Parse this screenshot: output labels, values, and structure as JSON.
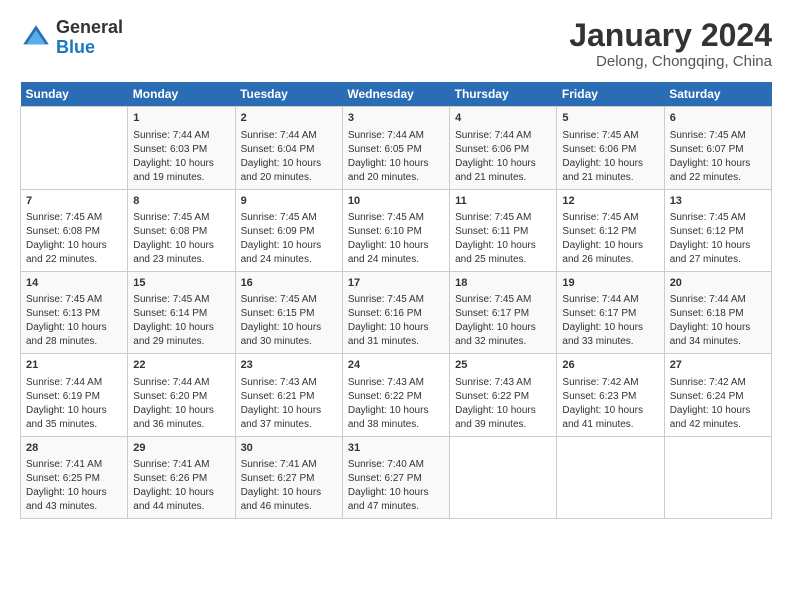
{
  "header": {
    "logo_general": "General",
    "logo_blue": "Blue",
    "month": "January 2024",
    "location": "Delong, Chongqing, China"
  },
  "days_of_week": [
    "Sunday",
    "Monday",
    "Tuesday",
    "Wednesday",
    "Thursday",
    "Friday",
    "Saturday"
  ],
  "weeks": [
    [
      {
        "day": "",
        "sunrise": "",
        "sunset": "",
        "daylight": ""
      },
      {
        "day": "1",
        "sunrise": "Sunrise: 7:44 AM",
        "sunset": "Sunset: 6:03 PM",
        "daylight": "Daylight: 10 hours and 19 minutes."
      },
      {
        "day": "2",
        "sunrise": "Sunrise: 7:44 AM",
        "sunset": "Sunset: 6:04 PM",
        "daylight": "Daylight: 10 hours and 20 minutes."
      },
      {
        "day": "3",
        "sunrise": "Sunrise: 7:44 AM",
        "sunset": "Sunset: 6:05 PM",
        "daylight": "Daylight: 10 hours and 20 minutes."
      },
      {
        "day": "4",
        "sunrise": "Sunrise: 7:44 AM",
        "sunset": "Sunset: 6:06 PM",
        "daylight": "Daylight: 10 hours and 21 minutes."
      },
      {
        "day": "5",
        "sunrise": "Sunrise: 7:45 AM",
        "sunset": "Sunset: 6:06 PM",
        "daylight": "Daylight: 10 hours and 21 minutes."
      },
      {
        "day": "6",
        "sunrise": "Sunrise: 7:45 AM",
        "sunset": "Sunset: 6:07 PM",
        "daylight": "Daylight: 10 hours and 22 minutes."
      }
    ],
    [
      {
        "day": "7",
        "sunrise": "Sunrise: 7:45 AM",
        "sunset": "Sunset: 6:08 PM",
        "daylight": "Daylight: 10 hours and 22 minutes."
      },
      {
        "day": "8",
        "sunrise": "Sunrise: 7:45 AM",
        "sunset": "Sunset: 6:08 PM",
        "daylight": "Daylight: 10 hours and 23 minutes."
      },
      {
        "day": "9",
        "sunrise": "Sunrise: 7:45 AM",
        "sunset": "Sunset: 6:09 PM",
        "daylight": "Daylight: 10 hours and 24 minutes."
      },
      {
        "day": "10",
        "sunrise": "Sunrise: 7:45 AM",
        "sunset": "Sunset: 6:10 PM",
        "daylight": "Daylight: 10 hours and 24 minutes."
      },
      {
        "day": "11",
        "sunrise": "Sunrise: 7:45 AM",
        "sunset": "Sunset: 6:11 PM",
        "daylight": "Daylight: 10 hours and 25 minutes."
      },
      {
        "day": "12",
        "sunrise": "Sunrise: 7:45 AM",
        "sunset": "Sunset: 6:12 PM",
        "daylight": "Daylight: 10 hours and 26 minutes."
      },
      {
        "day": "13",
        "sunrise": "Sunrise: 7:45 AM",
        "sunset": "Sunset: 6:12 PM",
        "daylight": "Daylight: 10 hours and 27 minutes."
      }
    ],
    [
      {
        "day": "14",
        "sunrise": "Sunrise: 7:45 AM",
        "sunset": "Sunset: 6:13 PM",
        "daylight": "Daylight: 10 hours and 28 minutes."
      },
      {
        "day": "15",
        "sunrise": "Sunrise: 7:45 AM",
        "sunset": "Sunset: 6:14 PM",
        "daylight": "Daylight: 10 hours and 29 minutes."
      },
      {
        "day": "16",
        "sunrise": "Sunrise: 7:45 AM",
        "sunset": "Sunset: 6:15 PM",
        "daylight": "Daylight: 10 hours and 30 minutes."
      },
      {
        "day": "17",
        "sunrise": "Sunrise: 7:45 AM",
        "sunset": "Sunset: 6:16 PM",
        "daylight": "Daylight: 10 hours and 31 minutes."
      },
      {
        "day": "18",
        "sunrise": "Sunrise: 7:45 AM",
        "sunset": "Sunset: 6:17 PM",
        "daylight": "Daylight: 10 hours and 32 minutes."
      },
      {
        "day": "19",
        "sunrise": "Sunrise: 7:44 AM",
        "sunset": "Sunset: 6:17 PM",
        "daylight": "Daylight: 10 hours and 33 minutes."
      },
      {
        "day": "20",
        "sunrise": "Sunrise: 7:44 AM",
        "sunset": "Sunset: 6:18 PM",
        "daylight": "Daylight: 10 hours and 34 minutes."
      }
    ],
    [
      {
        "day": "21",
        "sunrise": "Sunrise: 7:44 AM",
        "sunset": "Sunset: 6:19 PM",
        "daylight": "Daylight: 10 hours and 35 minutes."
      },
      {
        "day": "22",
        "sunrise": "Sunrise: 7:44 AM",
        "sunset": "Sunset: 6:20 PM",
        "daylight": "Daylight: 10 hours and 36 minutes."
      },
      {
        "day": "23",
        "sunrise": "Sunrise: 7:43 AM",
        "sunset": "Sunset: 6:21 PM",
        "daylight": "Daylight: 10 hours and 37 minutes."
      },
      {
        "day": "24",
        "sunrise": "Sunrise: 7:43 AM",
        "sunset": "Sunset: 6:22 PM",
        "daylight": "Daylight: 10 hours and 38 minutes."
      },
      {
        "day": "25",
        "sunrise": "Sunrise: 7:43 AM",
        "sunset": "Sunset: 6:22 PM",
        "daylight": "Daylight: 10 hours and 39 minutes."
      },
      {
        "day": "26",
        "sunrise": "Sunrise: 7:42 AM",
        "sunset": "Sunset: 6:23 PM",
        "daylight": "Daylight: 10 hours and 41 minutes."
      },
      {
        "day": "27",
        "sunrise": "Sunrise: 7:42 AM",
        "sunset": "Sunset: 6:24 PM",
        "daylight": "Daylight: 10 hours and 42 minutes."
      }
    ],
    [
      {
        "day": "28",
        "sunrise": "Sunrise: 7:41 AM",
        "sunset": "Sunset: 6:25 PM",
        "daylight": "Daylight: 10 hours and 43 minutes."
      },
      {
        "day": "29",
        "sunrise": "Sunrise: 7:41 AM",
        "sunset": "Sunset: 6:26 PM",
        "daylight": "Daylight: 10 hours and 44 minutes."
      },
      {
        "day": "30",
        "sunrise": "Sunrise: 7:41 AM",
        "sunset": "Sunset: 6:27 PM",
        "daylight": "Daylight: 10 hours and 46 minutes."
      },
      {
        "day": "31",
        "sunrise": "Sunrise: 7:40 AM",
        "sunset": "Sunset: 6:27 PM",
        "daylight": "Daylight: 10 hours and 47 minutes."
      },
      {
        "day": "",
        "sunrise": "",
        "sunset": "",
        "daylight": ""
      },
      {
        "day": "",
        "sunrise": "",
        "sunset": "",
        "daylight": ""
      },
      {
        "day": "",
        "sunrise": "",
        "sunset": "",
        "daylight": ""
      }
    ]
  ]
}
